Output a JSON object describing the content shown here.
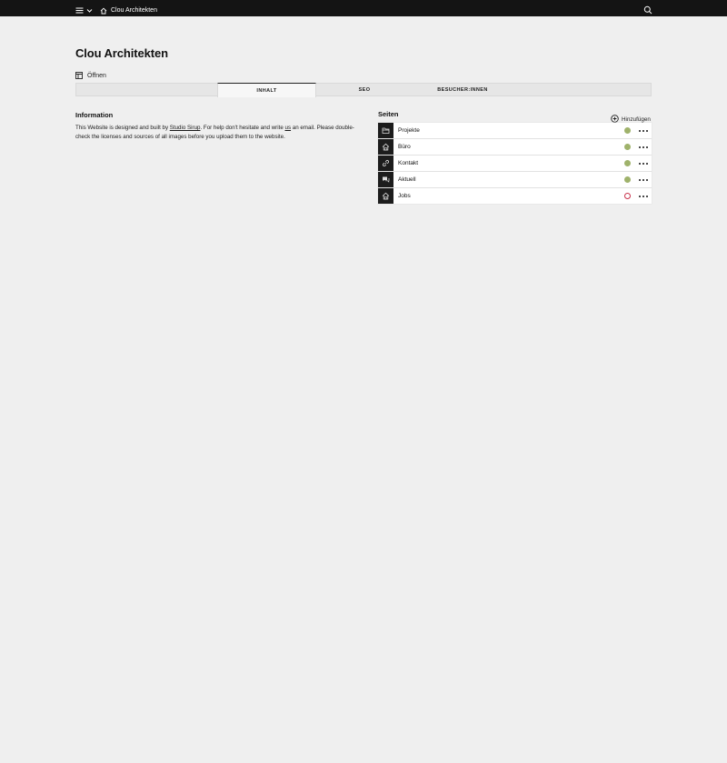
{
  "topbar": {
    "menu_icon": "hamburger-icon",
    "chevron_icon": "chevron-down-icon",
    "site_icon": "home-icon",
    "site_label": "Clou Architekten",
    "search_icon": "search-icon"
  },
  "page": {
    "title": "Clou Architekten",
    "open_icon": "preview-icon",
    "open_label": "Öffnen"
  },
  "tabs": [
    {
      "label": ""
    },
    {
      "label": "INHALT",
      "active": true
    },
    {
      "label": "SEO"
    },
    {
      "label": "BESUCHER:INNEN"
    }
  ],
  "information": {
    "heading": "Information",
    "text_1": "This Website is designed and built by ",
    "link_studio": "Studio Sirup",
    "text_2": ". For help don't hesitate and write ",
    "link_us": "us",
    "text_3": " an email. Please double-check the licenses and sources of all images before you upload them to the website."
  },
  "pages_section": {
    "heading": "Seiten",
    "add_icon": "plus-circle-icon",
    "add_label": "Hinzufügen",
    "items": [
      {
        "title": "Projekte",
        "icon": "folder-icon",
        "status": "listed"
      },
      {
        "title": "Büro",
        "icon": "home-icon",
        "status": "listed"
      },
      {
        "title": "Kontakt",
        "icon": "link-icon",
        "status": "listed"
      },
      {
        "title": "Aktuell",
        "icon": "chat-icon",
        "status": "listed"
      },
      {
        "title": "Jobs",
        "icon": "home-icon",
        "status": "draft"
      }
    ]
  },
  "colors": {
    "topbar": "#141414",
    "background": "#efefef",
    "status_listed": "#9fb26b",
    "status_draft": "#c8324b"
  }
}
